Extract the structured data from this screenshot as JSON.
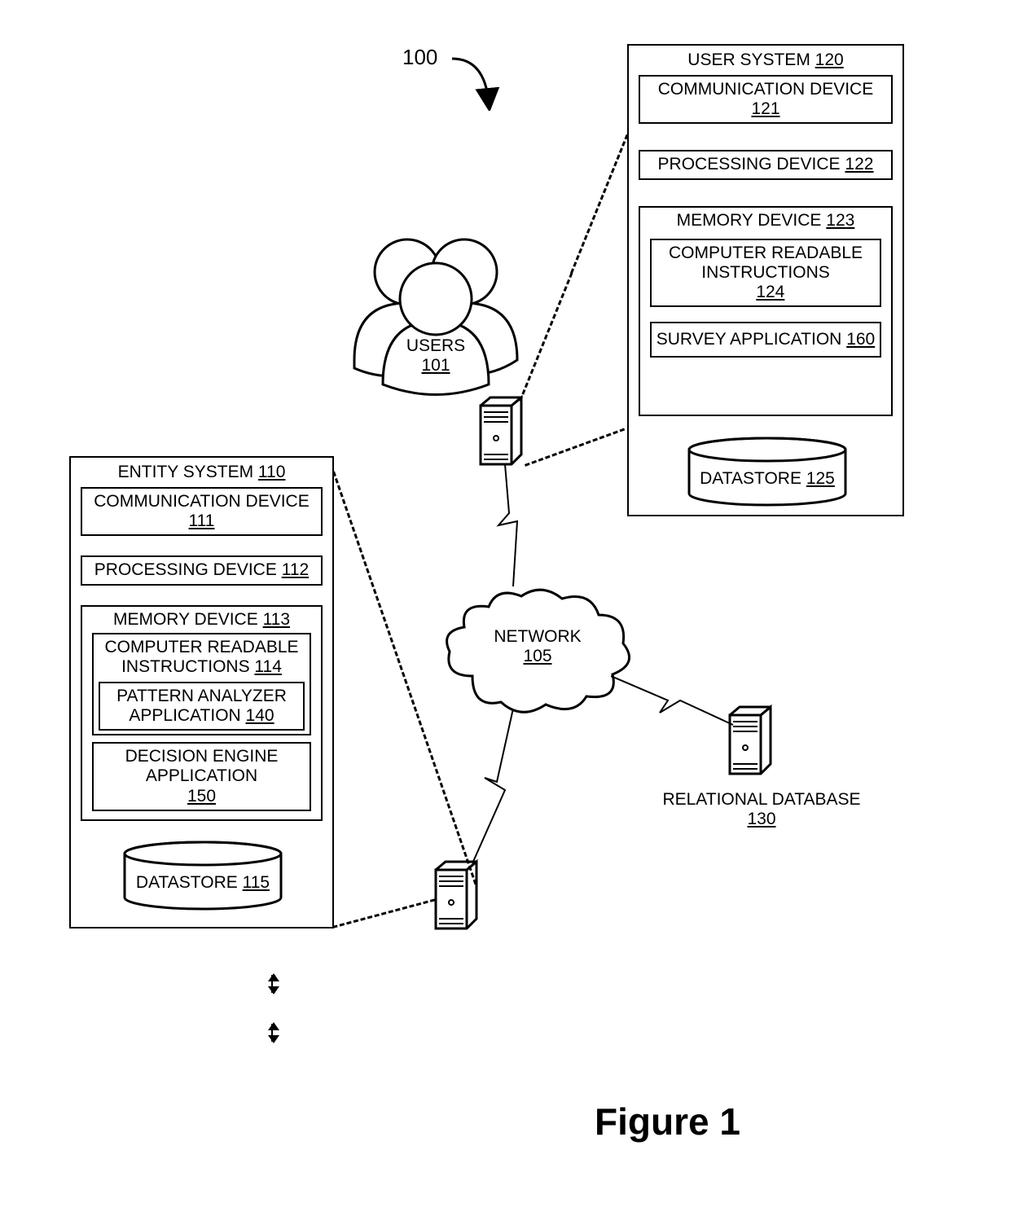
{
  "figure_caption": "Figure 1",
  "ref": {
    "label": "100"
  },
  "users": {
    "label": "USERS",
    "num": "101"
  },
  "network": {
    "label": "NETWORK",
    "num": "105"
  },
  "relational_db": {
    "label": "RELATIONAL DATABASE",
    "num": "130"
  },
  "entity": {
    "title": "ENTITY SYSTEM",
    "title_num": "110",
    "comm": "COMMUNICATION DEVICE",
    "comm_num": "111",
    "proc": "PROCESSING DEVICE",
    "proc_num": "112",
    "mem": "MEMORY DEVICE",
    "mem_num": "113",
    "cri": "COMPUTER READABLE INSTRUCTIONS",
    "cri_num": "114",
    "pa": "PATTERN ANALYZER APPLICATION",
    "pa_num": "140",
    "de": "DECISION ENGINE APPLICATION",
    "de_num": "150",
    "ds": "DATASTORE",
    "ds_num": "115"
  },
  "usersys": {
    "title": "USER SYSTEM",
    "title_num": "120",
    "comm": "COMMUNICATION DEVICE",
    "comm_num": "121",
    "proc": "PROCESSING DEVICE",
    "proc_num": "122",
    "mem": "MEMORY DEVICE",
    "mem_num": "123",
    "cri": "COMPUTER READABLE INSTRUCTIONS",
    "cri_num": "124",
    "sa": "SURVEY APPLICATION",
    "sa_num": "160",
    "ds": "DATASTORE",
    "ds_num": "125"
  }
}
